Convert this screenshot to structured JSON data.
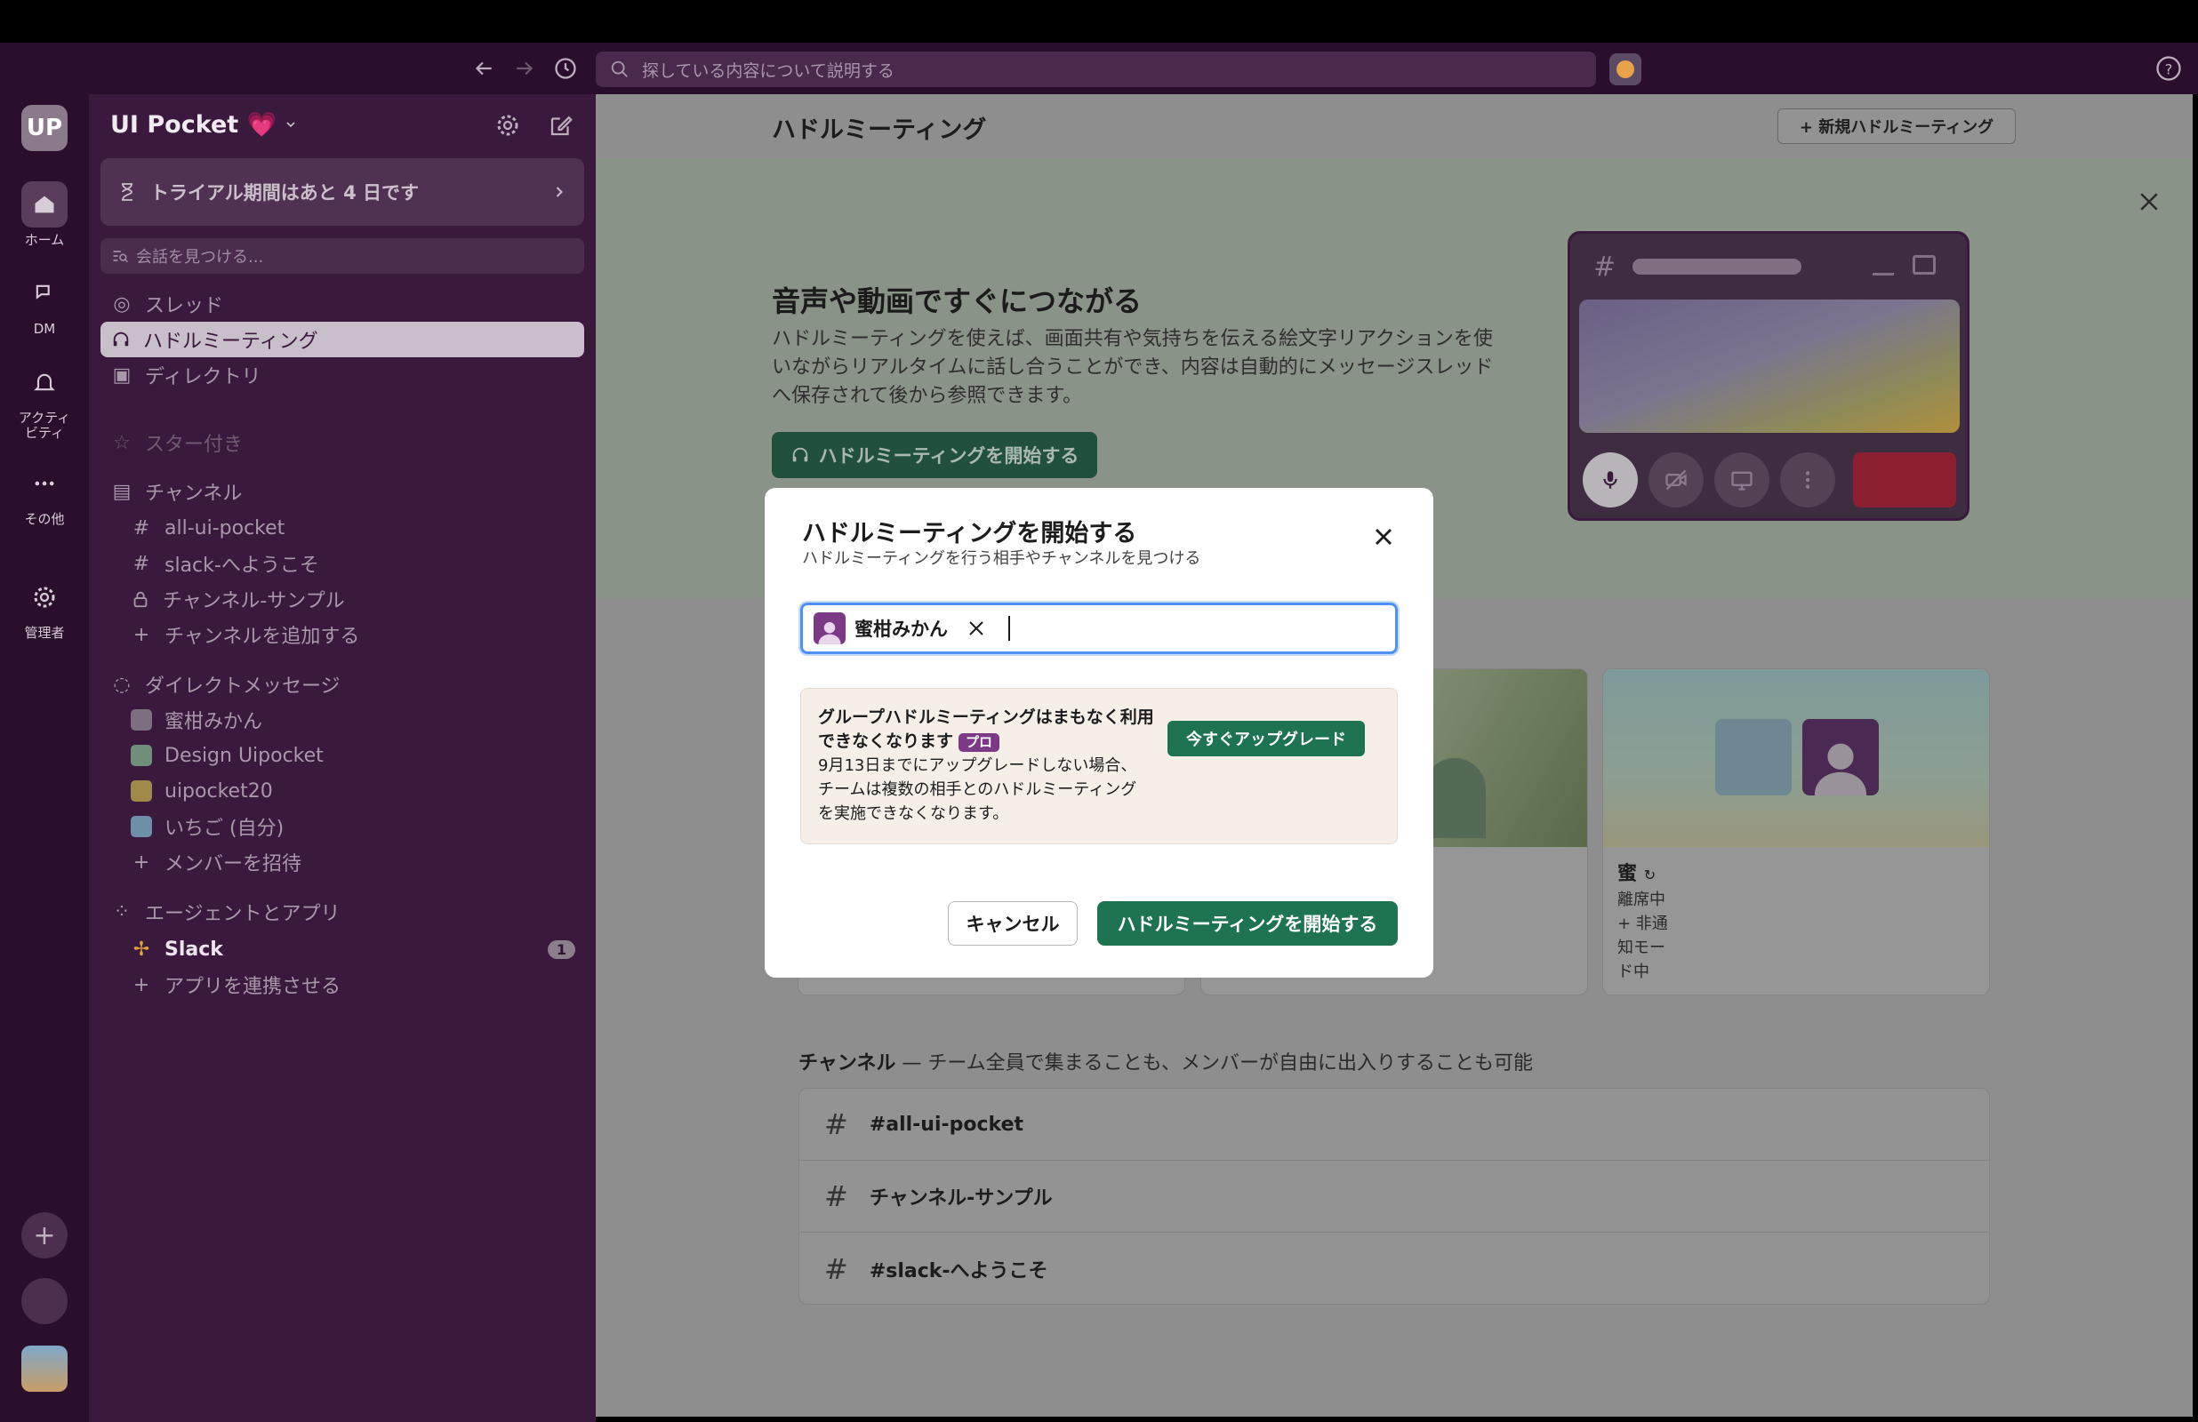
{
  "topbar": {
    "search_placeholder": "探している内容について説明する"
  },
  "rail": {
    "workspace_initials": "UP",
    "items": [
      {
        "label": "ホーム",
        "icon": "home-icon"
      },
      {
        "label": "DM",
        "icon": "dm-icon"
      },
      {
        "label": "アクティビティ",
        "icon": "bell-icon"
      },
      {
        "label": "その他",
        "icon": "more-icon"
      },
      {
        "label": "管理者",
        "icon": "gear-icon"
      }
    ]
  },
  "sidebar": {
    "workspace_name": "UI Pocket 💗",
    "trial_text": "トライアル期間はあと 4 日です",
    "find_placeholder": "会話を見つける...",
    "nav": [
      {
        "label": "スレッド"
      },
      {
        "label": "ハドルミーティング",
        "active": true
      },
      {
        "label": "ディレクトリ"
      }
    ],
    "starred_label": "スター付き",
    "channels_label": "チャンネル",
    "channels": [
      "all-ui-pocket",
      "slack-へようこそ",
      "チャンネル-サンプル",
      "チャンネルを追加する"
    ],
    "dm_label": "ダイレクトメッセージ",
    "dms": [
      "蜜柑みかん",
      "Design Uipocket",
      "uipocket20",
      "いちご (自分)",
      "メンバーを招待"
    ],
    "apps_label": "エージェントとアプリ",
    "apps": [
      {
        "label": "Slack",
        "badge": "1"
      },
      {
        "label": "アプリを連携させる"
      }
    ]
  },
  "main": {
    "title": "ハドルミーティング",
    "new_huddle_label": "+ 新規ハドルミーティング",
    "banner": {
      "heading": "音声や動画ですぐにつながる",
      "text": "ハドルミーティングを使えば、画面共有や気持ちを伝える絵文字リアクションを使いながらリアルタイムに話し合うことができ、内容は自動的にメッセージスレッドへ保存されて後から参照できます。",
      "start_label": "ハドルミーティングを開始する"
    },
    "member_card": {
      "name": "蜜",
      "status_lines": [
        "離席中",
        "+ 非通",
        "知モー",
        "ド中"
      ]
    },
    "channels_heading_bold": "チャンネル",
    "channels_heading_rest": " — チーム全員で集まることも、メンバーが自由に出入りすることも可能",
    "channel_rows": [
      "#all-ui-pocket",
      "チャンネル-サンプル",
      "#slack-へようこそ"
    ]
  },
  "modal": {
    "title": "ハドルミーティングを開始する",
    "subtitle": "ハドルミーティングを行う相手やチャンネルを見つける",
    "chip_name": "蜜柑みかん",
    "notice_title": "グループハドルミーティングはまもなく利用できなくなります",
    "pro_badge": "プロ",
    "notice_text": "9月13日までにアップグレードしない場合、チームは複数の相手とのハドルミーティングを実施できなくなります。",
    "upgrade_label": "今すぐアップグレード",
    "cancel_label": "キャンセル",
    "confirm_label": "ハドルミーティングを開始する"
  }
}
